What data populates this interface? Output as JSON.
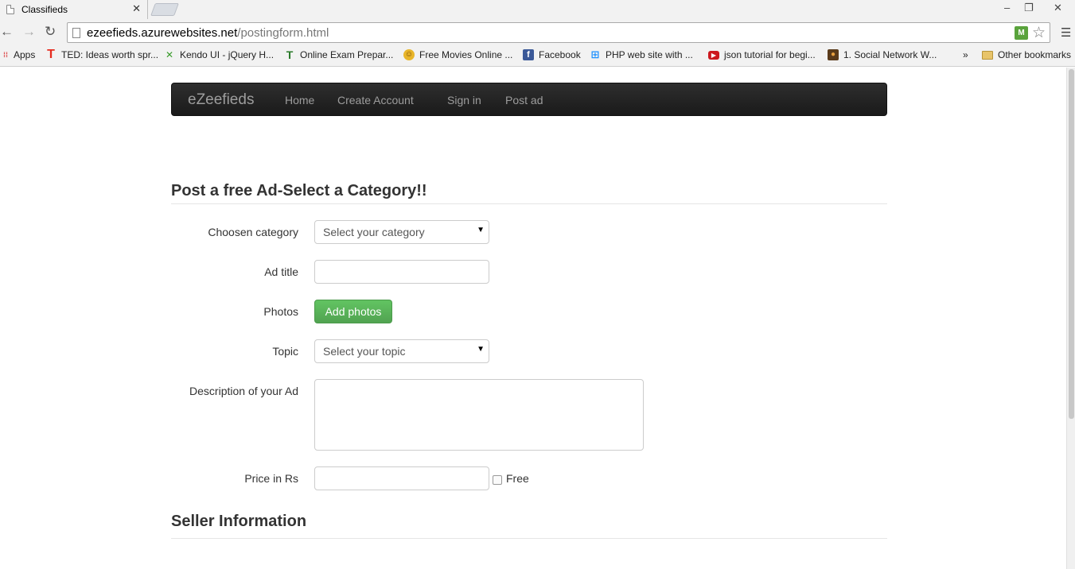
{
  "browser": {
    "tab_title": "Classifieds",
    "tab_close": "✕",
    "url_host": "ezeefieds.azurewebsites.net",
    "url_path": "/postingform.html",
    "window_controls": [
      "–",
      "❐",
      "✕"
    ]
  },
  "bookmarks": {
    "apps": "Apps",
    "items": [
      {
        "label": "TED: Ideas worth spr...",
        "icon": "ted-icon",
        "color": "#e62b1e"
      },
      {
        "label": "Kendo UI - jQuery H...",
        "icon": "kendo-icon",
        "color": "#3a9c2c"
      },
      {
        "label": "Online Exam Prepar...",
        "icon": "t-icon",
        "color": "#2a7a2a"
      },
      {
        "label": "Free Movies Online ...",
        "icon": "smiley-icon",
        "color": "#e8b52a"
      },
      {
        "label": "Facebook",
        "icon": "facebook-icon",
        "color": "#3b5998"
      },
      {
        "label": "PHP web site with ...",
        "icon": "windows-icon",
        "color": "#1e90ff"
      },
      {
        "label": "json tutorial for begi...",
        "icon": "youtube-icon",
        "color": "#cc181e"
      },
      {
        "label": "1. Social Network W...",
        "icon": "bookmark-icon",
        "color": "#c06b22"
      }
    ],
    "overflow": "»",
    "other": "Other bookmarks"
  },
  "navbar": {
    "brand": "eZeefieds",
    "links": [
      "Home",
      "Create Account",
      "Sign in",
      "Post ad"
    ]
  },
  "form": {
    "heading": "Post a free Ad-Select a Category!!",
    "category_label": "Choosen category",
    "category_value": "Select your category",
    "title_label": "Ad title",
    "photos_label": "Photos",
    "photos_button": "Add photos",
    "topic_label": "Topic",
    "topic_value": "Select your topic",
    "description_label": "Description of your Ad",
    "price_label": "Price in Rs",
    "free_label": "Free"
  },
  "seller": {
    "heading": "Seller Information"
  }
}
